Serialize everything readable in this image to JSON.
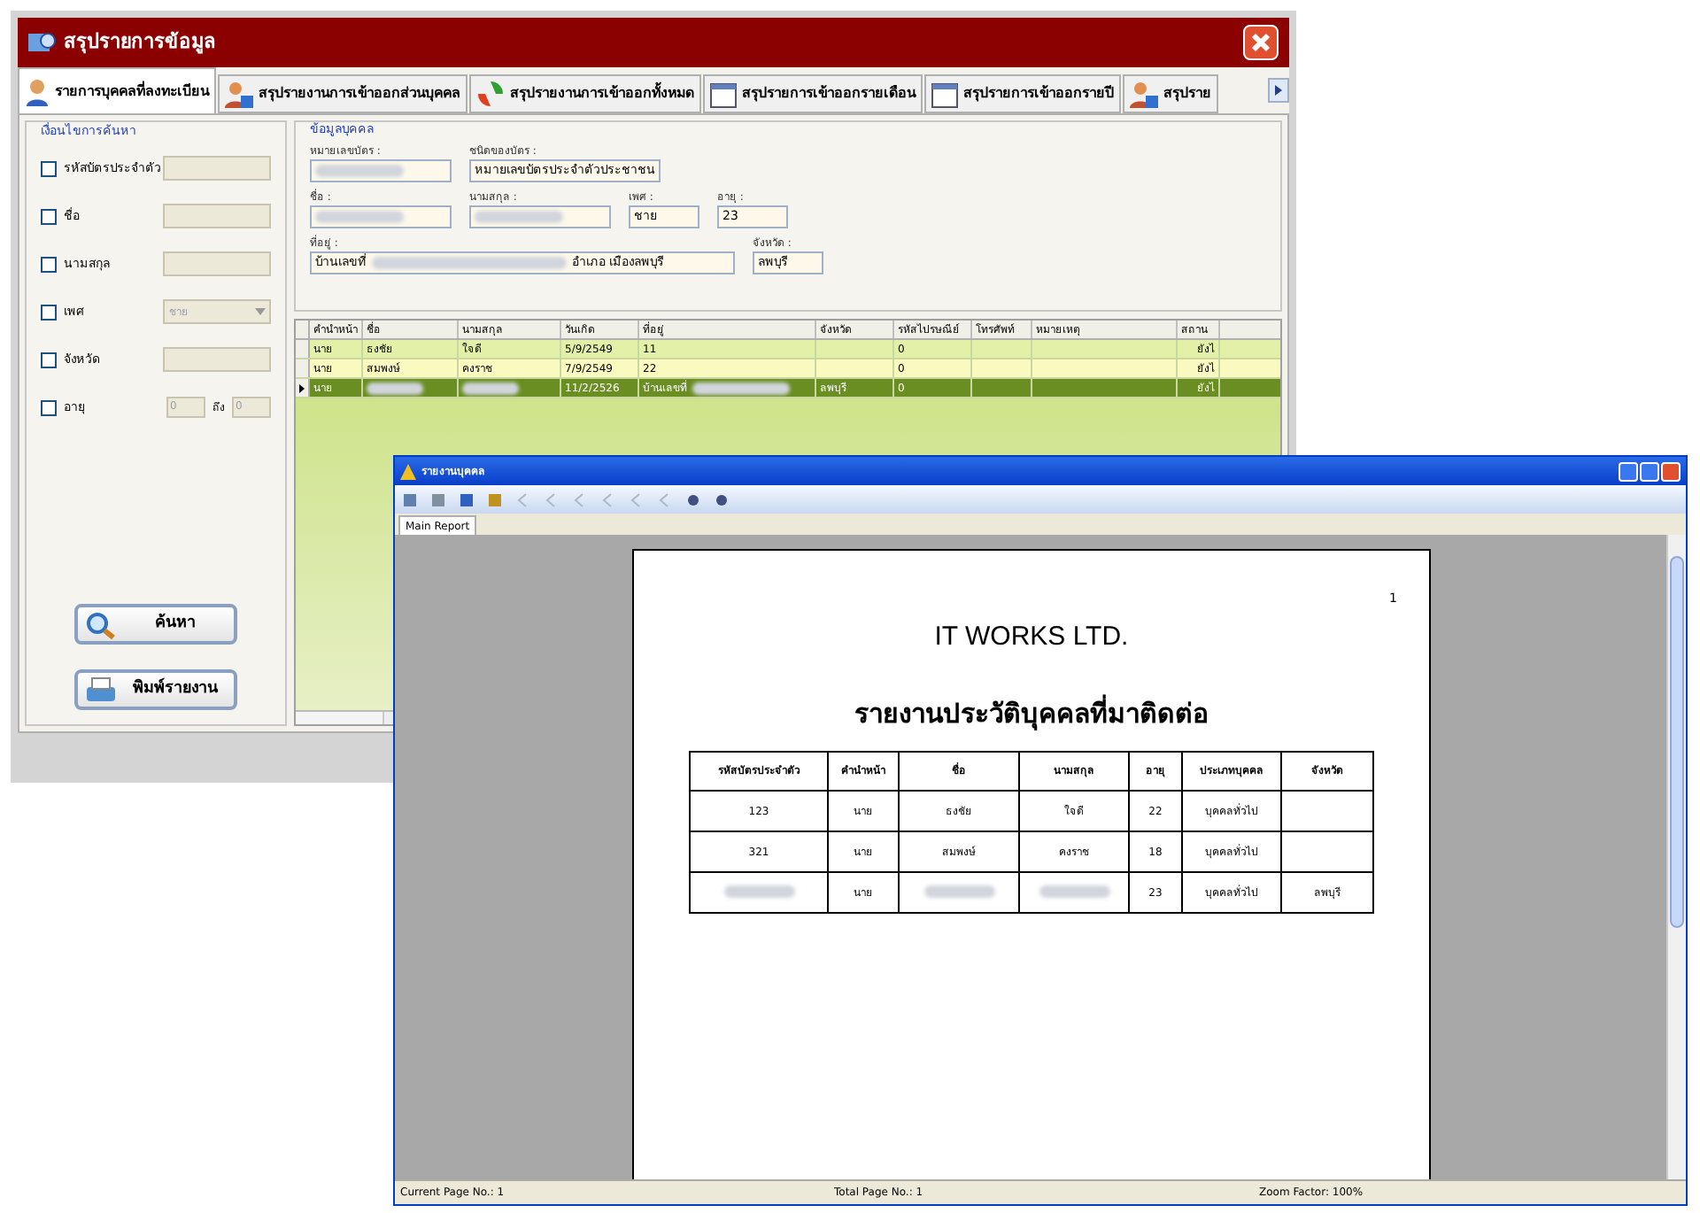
{
  "main_window": {
    "title": "สรุปรายการข้อมูล",
    "tabs": [
      {
        "label": "รายการบุคคลที่ลงทะเบียน",
        "selected": true
      },
      {
        "label": "สรุปรายงานการเข้าออกส่วนบุคคล",
        "selected": false
      },
      {
        "label": "สรุปรายงานการเข้าออกทั้งหมด",
        "selected": false
      },
      {
        "label": "สรุปรายการเข้าออกรายเดือน",
        "selected": false
      },
      {
        "label": "สรุปรายการเข้าออกรายปี",
        "selected": false
      },
      {
        "label": "สรุปราย",
        "selected": false
      }
    ],
    "search_panel": {
      "title": "เงื่อนไขการค้นหา",
      "filters": [
        {
          "kind": "text",
          "label": "รหัสบัตรประจำตัว",
          "checked": false
        },
        {
          "kind": "text",
          "label": "ชื่อ",
          "checked": false
        },
        {
          "kind": "text",
          "label": "นามสกุล",
          "checked": false
        },
        {
          "kind": "select",
          "label": "เพศ",
          "checked": false,
          "value": "ชาย"
        },
        {
          "kind": "text",
          "label": "จังหวัด",
          "checked": false
        },
        {
          "kind": "range",
          "label": "อายุ",
          "checked": false,
          "from": "0",
          "to_label": "ถึง",
          "to": "0"
        }
      ],
      "buttons": [
        {
          "label": "ค้นหา"
        },
        {
          "label": "พิมพ์รายงาน"
        }
      ]
    },
    "person_panel": {
      "title": "ข้อมูลบุคคล",
      "rows": [
        [
          {
            "label": "หมายเลขบัตร :",
            "blurred": true
          },
          {
            "label": "ชนิดของบัตร :",
            "value": "หมายเลขบัตรประจำตัวประชาชน"
          }
        ],
        [
          {
            "label": "ชื่อ :",
            "blurred": true
          },
          {
            "label": "นามสกุล :",
            "blurred": true
          },
          {
            "label": "เพศ :",
            "value": "ชาย"
          },
          {
            "label": "อายุ :",
            "value": "23"
          }
        ],
        [
          {
            "label": "ที่อยู่ :",
            "value": "บ้านเลขที่",
            "value_end": "อำเภอ เมืองลพบุรี",
            "blurred": true
          },
          {
            "label": "จังหวัด :",
            "value": "ลพบุรี"
          }
        ]
      ]
    },
    "grid": {
      "columns": [
        "คำนำหน้า",
        "ชื่อ",
        "นามสกุล",
        "วันเกิด",
        "ที่อยู่",
        "จังหวัด",
        "รหัสไปรษณีย์",
        "โทรศัพท์",
        "หมายเหตุ",
        "สถาน"
      ],
      "rows": [
        {
          "selected": false,
          "cells": [
            "นาย",
            "ธงชัย",
            "ใจดี",
            "5/9/2549",
            "11",
            null,
            "0",
            null,
            null,
            "ยังไ"
          ]
        },
        {
          "selected": false,
          "cells": [
            "นาย",
            "สมพงษ์",
            "คงราช",
            "7/9/2549",
            "22",
            null,
            "0",
            null,
            null,
            "ยังไ"
          ]
        },
        {
          "selected": true,
          "cells": [
            "นาย",
            {
              "kind": "blurred"
            },
            {
              "kind": "blurred"
            },
            "11/2/2526",
            {
              "kind": "partial",
              "text": "บ้านเลขที่"
            },
            "ลพบุรี",
            "0",
            null,
            null,
            "ยังไ"
          ]
        }
      ]
    }
  },
  "report_window": {
    "title": "รายงานบุคคล",
    "tab": "Main Report",
    "page_number": "1",
    "company": "IT WORKS LTD.",
    "report_title": "รายงานประวัติบุคคลที่มาติดต่อ",
    "columns": [
      "รหัสบัตรประจำตัว",
      "คำนำหน้า",
      "ชื่อ",
      "นามสกุล",
      "อายุ",
      "ประเภทบุคคล",
      "จังหวัด"
    ],
    "rows": [
      [
        "123",
        "นาย",
        "ธงชัย",
        "ใจดี",
        "22",
        "บุคคลทั่วไป",
        null
      ],
      [
        "321",
        "นาย",
        "สมพงษ์",
        "คงราช",
        "18",
        "บุคคลทั่วไป",
        null
      ],
      [
        {
          "kind": "blurred"
        },
        "นาย",
        {
          "kind": "blurred"
        },
        {
          "kind": "blurred"
        },
        "23",
        "บุคคลทั่วไป",
        "ลพบุรี"
      ]
    ],
    "status_bar": [
      "Current Page No.: 1",
      "Total Page No.: 1",
      "Zoom Factor: 100%"
    ]
  }
}
